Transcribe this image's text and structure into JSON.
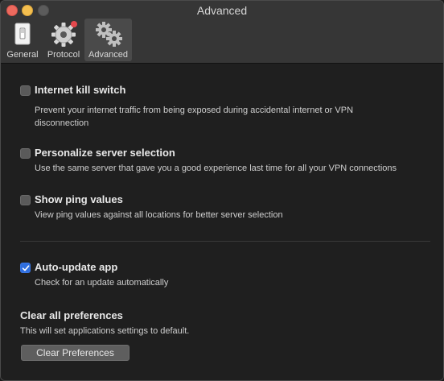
{
  "window": {
    "title": "Advanced"
  },
  "toolbar": {
    "tabs": [
      {
        "label": "General",
        "icon": "switch-icon"
      },
      {
        "label": "Protocol",
        "icon": "gear-icon"
      },
      {
        "label": "Advanced",
        "icon": "gears-icon",
        "selected": true
      }
    ],
    "notification_color": "#e5484d"
  },
  "settings": {
    "kill_switch": {
      "label": "Internet kill switch",
      "description": "Prevent your internet traffic from being exposed during accidental internet or VPN disconnection",
      "checked": false
    },
    "personalize": {
      "label": "Personalize server selection",
      "description": "Use the same server that gave you a good experience last time for all your VPN connections",
      "checked": false
    },
    "ping": {
      "label": "Show ping values",
      "description": "View ping values against all locations for better server selection",
      "checked": false
    },
    "auto_update": {
      "label": "Auto-update app",
      "description": "Check for an update automatically",
      "checked": true
    }
  },
  "clear": {
    "title": "Clear all preferences",
    "description": "This will set applications settings to default.",
    "button_label": "Clear Preferences"
  },
  "colors": {
    "accent": "#2f6fe0",
    "background": "#1f1f1f",
    "toolbar": "#363636"
  }
}
